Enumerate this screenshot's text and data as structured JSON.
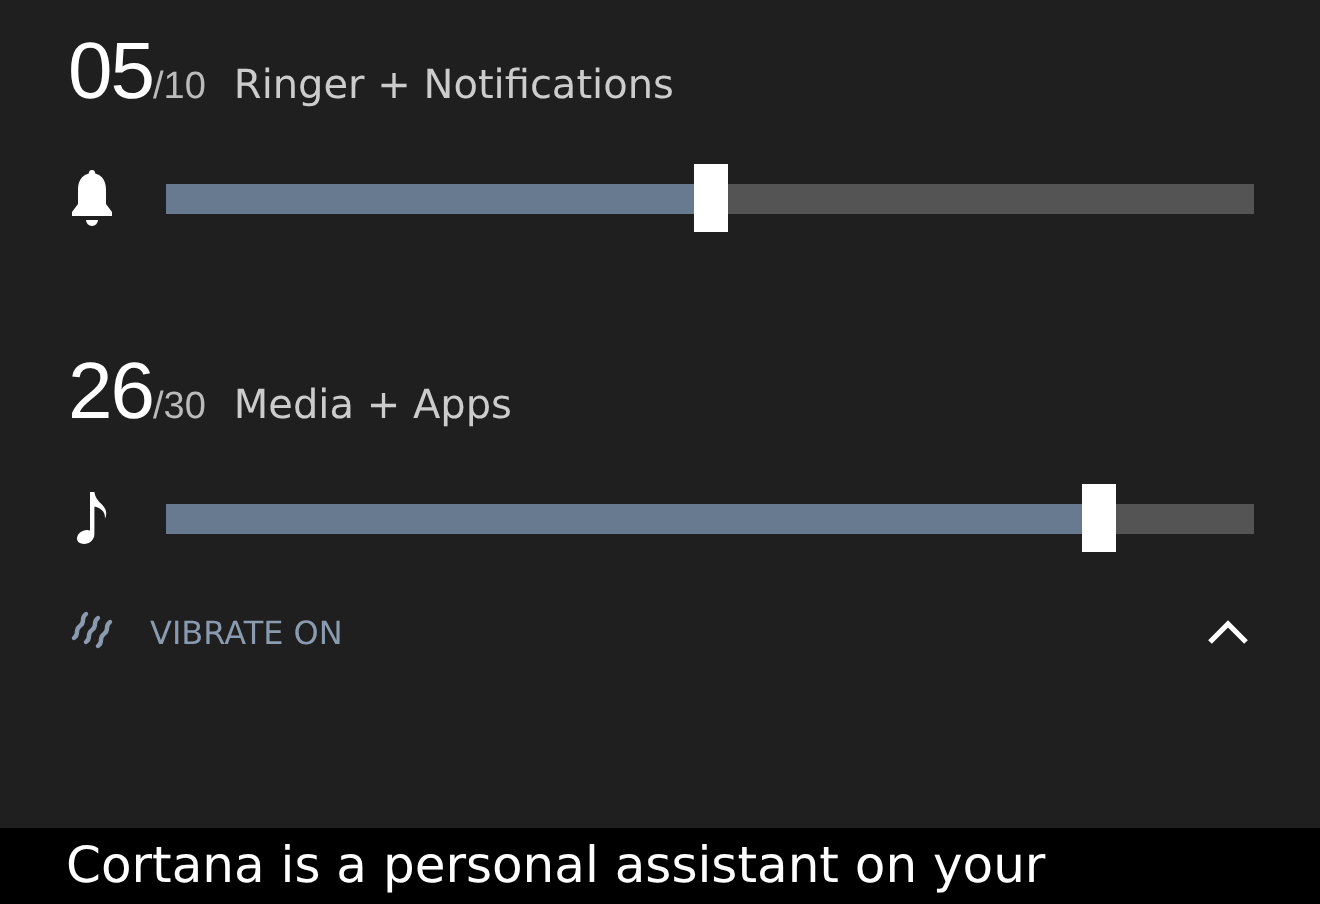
{
  "volumes": [
    {
      "value": "05",
      "max": "/10",
      "label": "Ringer + Notifications",
      "level": 0.5
    },
    {
      "value": "26",
      "max": "/30",
      "label": "Media + Apps",
      "level": 0.856
    }
  ],
  "vibrate": {
    "label": "VIBRATE ON"
  },
  "banner": {
    "text": "Cortana is a personal assistant on your"
  }
}
